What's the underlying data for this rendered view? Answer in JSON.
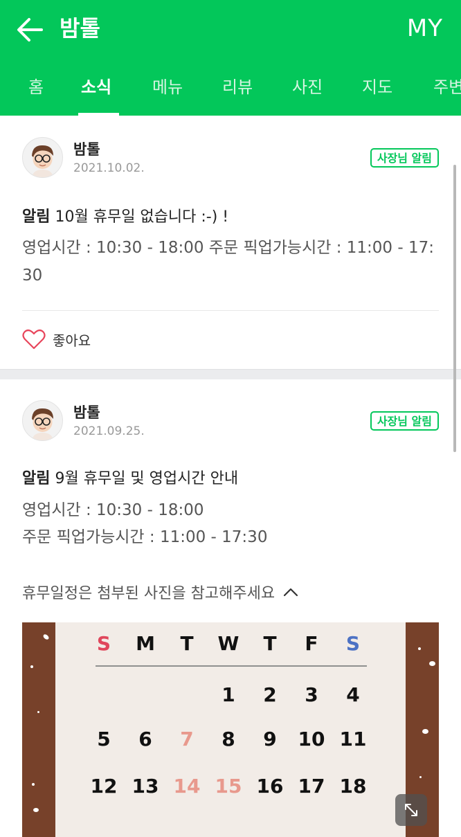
{
  "header": {
    "title": "밤톨",
    "my_label": "MY",
    "background": "#03c75a"
  },
  "tabs": [
    {
      "label": "홈",
      "active": false
    },
    {
      "label": "소식",
      "active": true
    },
    {
      "label": "메뉴",
      "active": false
    },
    {
      "label": "리뷰",
      "active": false
    },
    {
      "label": "사진",
      "active": false
    },
    {
      "label": "지도",
      "active": false
    },
    {
      "label": "주변",
      "active": false
    }
  ],
  "posts": [
    {
      "author": "밤톨",
      "date": "2021.10.02.",
      "badge": "사장님 알림",
      "tag": "알림",
      "headline": "10월 휴무일 없습니다 :-) !",
      "body": "영업시간 : 10:30 - 18:00 주문 픽업가능시간 : 11:00 - 17:30",
      "like_label": "좋아요"
    },
    {
      "author": "밤톨",
      "date": "2021.09.25.",
      "badge": "사장님 알림",
      "tag": "알림",
      "headline": "9월 휴무일 및 영업시간 안내",
      "body_lines": [
        "영업시간 : 10:30 - 18:00",
        "주문 픽업가능시간 : 11:00 - 17:30"
      ],
      "notice": "휴무일정은 첨부된 사진을 참고해주세요",
      "calendar": {
        "weekdays": [
          "S",
          "M",
          "T",
          "W",
          "T",
          "F",
          "S"
        ],
        "rows": [
          [
            "",
            "",
            "",
            "1",
            "2",
            "3",
            "4"
          ],
          [
            "5",
            "6",
            "7",
            "8",
            "9",
            "10",
            "11"
          ],
          [
            "12",
            "13",
            "14",
            "15",
            "16",
            "17",
            "18"
          ]
        ],
        "holiday_days": [
          "7",
          "14",
          "15"
        ],
        "holiday_color": "#e8998d",
        "sunday_color": "#e0475c",
        "saturday_color": "#4d72c4"
      }
    }
  ],
  "icons": {
    "back": "arrow-left-icon",
    "like": "heart-outline-icon",
    "collapse": "chevron-up-icon",
    "expand": "expand-icon"
  },
  "colors": {
    "accent": "#03c75a",
    "separator": "#ebecee"
  }
}
